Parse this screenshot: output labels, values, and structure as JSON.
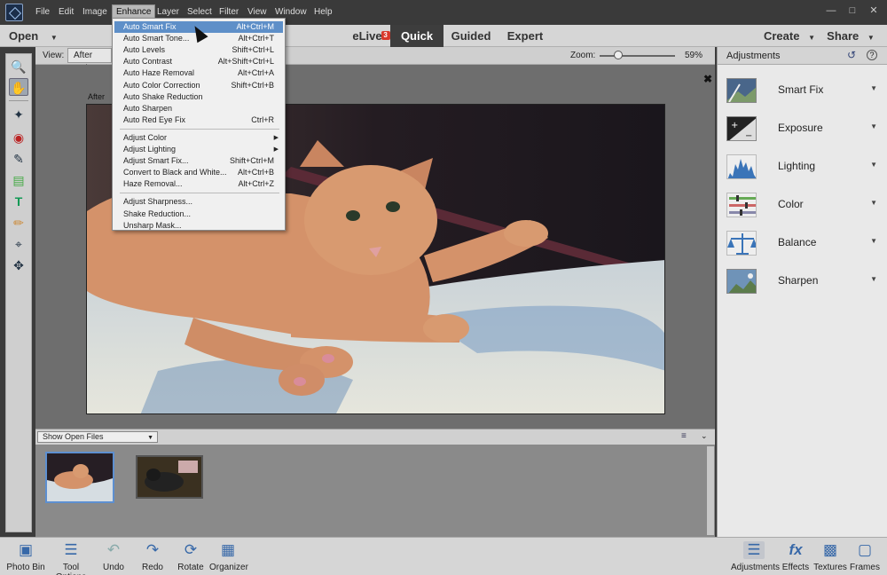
{
  "menubar": {
    "items": [
      "File",
      "Edit",
      "Image",
      "Enhance",
      "Layer",
      "Select",
      "Filter",
      "View",
      "Window",
      "Help"
    ],
    "active": "Enhance"
  },
  "modebar": {
    "open_label": "Open",
    "elive_label": "eLive",
    "elive_badge": "3",
    "modes": [
      "Quick",
      "Guided",
      "Expert"
    ],
    "selected_mode": "Quick",
    "create_label": "Create",
    "share_label": "Share"
  },
  "options": {
    "view_label": "View:",
    "view_value": "After Only",
    "zoom_label": "Zoom:",
    "zoom_value": "59%",
    "zoom_fraction": 0.25
  },
  "canvas": {
    "after_label": "After"
  },
  "bin": {
    "dropdown_value": "Show Open Files"
  },
  "panel": {
    "title": "Adjustments",
    "items": [
      "Smart Fix",
      "Exposure",
      "Lighting",
      "Color",
      "Balance",
      "Sharpen"
    ]
  },
  "bottom": {
    "left": [
      "Photo Bin",
      "Tool Options",
      "Undo",
      "Redo",
      "Rotate",
      "Organizer"
    ],
    "right": [
      "Adjustments",
      "Effects",
      "Textures",
      "Frames"
    ]
  },
  "enhance_menu": {
    "group1": [
      {
        "label": "Auto Smart Fix",
        "shortcut": "Alt+Ctrl+M"
      },
      {
        "label": "Auto Smart Tone...",
        "shortcut": "Alt+Ctrl+T"
      },
      {
        "label": "Auto Levels",
        "shortcut": "Shift+Ctrl+L"
      },
      {
        "label": "Auto Contrast",
        "shortcut": "Alt+Shift+Ctrl+L"
      },
      {
        "label": "Auto Haze Removal",
        "shortcut": "Alt+Ctrl+A"
      },
      {
        "label": "Auto Color Correction",
        "shortcut": "Shift+Ctrl+B"
      },
      {
        "label": "Auto Shake Reduction",
        "shortcut": ""
      },
      {
        "label": "Auto Sharpen",
        "shortcut": ""
      },
      {
        "label": "Auto Red Eye Fix",
        "shortcut": "Ctrl+R"
      }
    ],
    "group2": [
      {
        "label": "Adjust Color",
        "shortcut": "",
        "submenu": true
      },
      {
        "label": "Adjust Lighting",
        "shortcut": "",
        "submenu": true
      },
      {
        "label": "Adjust Smart Fix...",
        "shortcut": "Shift+Ctrl+M"
      },
      {
        "label": "Convert to Black and White...",
        "shortcut": "Alt+Ctrl+B"
      },
      {
        "label": "Haze Removal...",
        "shortcut": "Alt+Ctrl+Z"
      }
    ],
    "group3": [
      {
        "label": "Adjust Sharpness...",
        "shortcut": ""
      },
      {
        "label": "Shake Reduction...",
        "shortcut": ""
      },
      {
        "label": "Unsharp Mask...",
        "shortcut": ""
      }
    ],
    "highlighted": "Auto Smart Fix"
  }
}
